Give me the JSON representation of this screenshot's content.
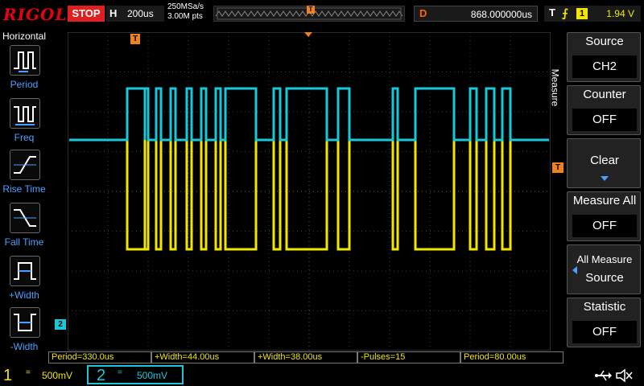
{
  "brand": "RIGOL",
  "status": "STOP",
  "horizontal": {
    "key": "H",
    "timebase": "200us"
  },
  "sample": {
    "rate": "250MSa/s",
    "points": "3.00M pts"
  },
  "delay": {
    "key": "D",
    "value": "868.000000us"
  },
  "trigger": {
    "key": "T",
    "edge": "⨍",
    "source": "1",
    "level": "1.94 V"
  },
  "left_menu": {
    "title": "Horizontal",
    "items": [
      {
        "label": "Period",
        "icon": "period-icon"
      },
      {
        "label": "Freq",
        "icon": "freq-icon"
      },
      {
        "label": "Rise Time",
        "icon": "rise-time-icon"
      },
      {
        "label": "Fall Time",
        "icon": "fall-time-icon"
      },
      {
        "label": "+Width",
        "icon": "positive-width-icon"
      },
      {
        "label": "-Width",
        "icon": "negative-width-icon"
      }
    ]
  },
  "right_menu": {
    "title": "Measure",
    "items": [
      {
        "title": "Source",
        "value": "CH2"
      },
      {
        "title": "Counter",
        "value": "OFF"
      },
      {
        "title": "Clear",
        "value": ""
      },
      {
        "title": "Measure All",
        "value": "OFF"
      },
      {
        "title": "All Measure",
        "value": "Source"
      },
      {
        "title": "Statistic",
        "value": "OFF"
      }
    ]
  },
  "measurements": [
    "Period=330.0us",
    "+Width=44.00us",
    "+Width=38.00us",
    "-Pulses=15",
    "Period=80.00us"
  ],
  "markers": {
    "trigger_pos": "T",
    "ch2_marker": "2",
    "trig_level": "T"
  },
  "channels": [
    {
      "num": "1",
      "coupling": "=",
      "scale": "500mV",
      "color": "#f2e600"
    },
    {
      "num": "2",
      "coupling": "=",
      "scale": "500mV",
      "color": "#19c8d8"
    }
  ],
  "colors": {
    "ch1": "#f2e600",
    "ch2": "#19c8d8",
    "accent": "#4aa0ff",
    "stop": "#e02020",
    "marker": "#f08020"
  },
  "icons": {
    "usb": "usb-icon",
    "speaker": "speaker-mute-icon"
  }
}
